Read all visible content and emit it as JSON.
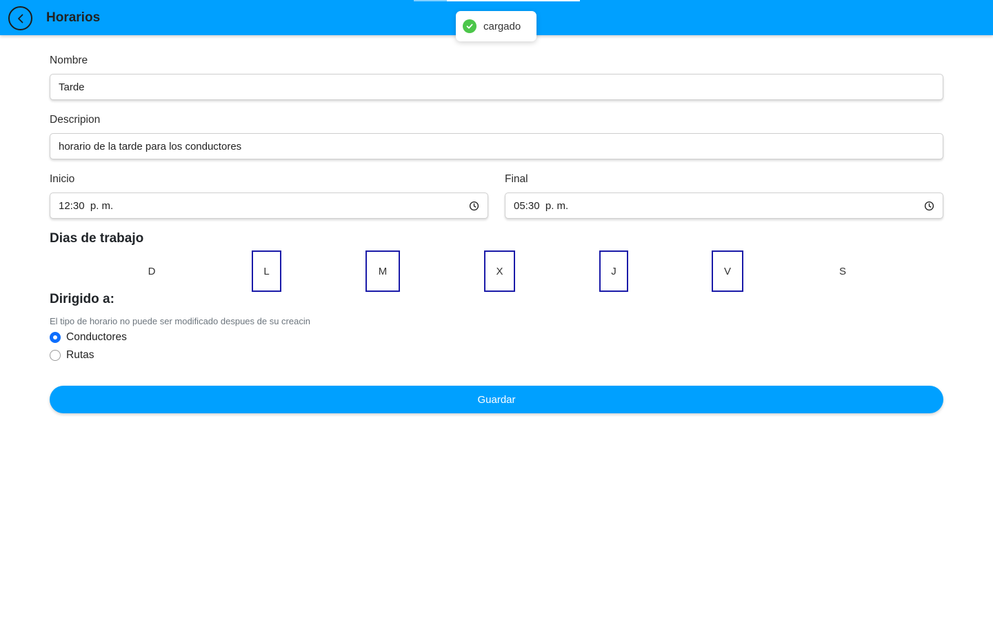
{
  "header": {
    "title": "Horarios",
    "back_icon": "chevron-left-icon",
    "color": "#00a0ff"
  },
  "toast": {
    "message": "cargado",
    "icon": "check-circle-icon",
    "icon_color": "#4cc64a"
  },
  "form": {
    "name": {
      "label": "Nombre",
      "value": "Tarde"
    },
    "description": {
      "label": "Descripion",
      "value": "horario de la tarde para los conductores"
    },
    "start": {
      "label": "Inicio",
      "value": "12:30  p. m.",
      "icon": "clock-icon"
    },
    "end": {
      "label": "Final",
      "value": "05:30  p. m.",
      "icon": "clock-icon"
    }
  },
  "workdays": {
    "title": "Dias de trabajo",
    "days": [
      {
        "label": "D",
        "selected": false
      },
      {
        "label": "L",
        "selected": true
      },
      {
        "label": "M",
        "selected": true
      },
      {
        "label": "X",
        "selected": true
      },
      {
        "label": "J",
        "selected": true
      },
      {
        "label": "V",
        "selected": true
      },
      {
        "label": "S",
        "selected": false
      }
    ],
    "selected_color": "#1a1aa8"
  },
  "target": {
    "title": "Dirigido a:",
    "hint": "El tipo de horario no puede ser modificado despues de su creacin",
    "options": [
      {
        "label": "Conductores",
        "checked": true
      },
      {
        "label": "Rutas",
        "checked": false
      }
    ]
  },
  "save_button": {
    "label": "Guardar"
  }
}
